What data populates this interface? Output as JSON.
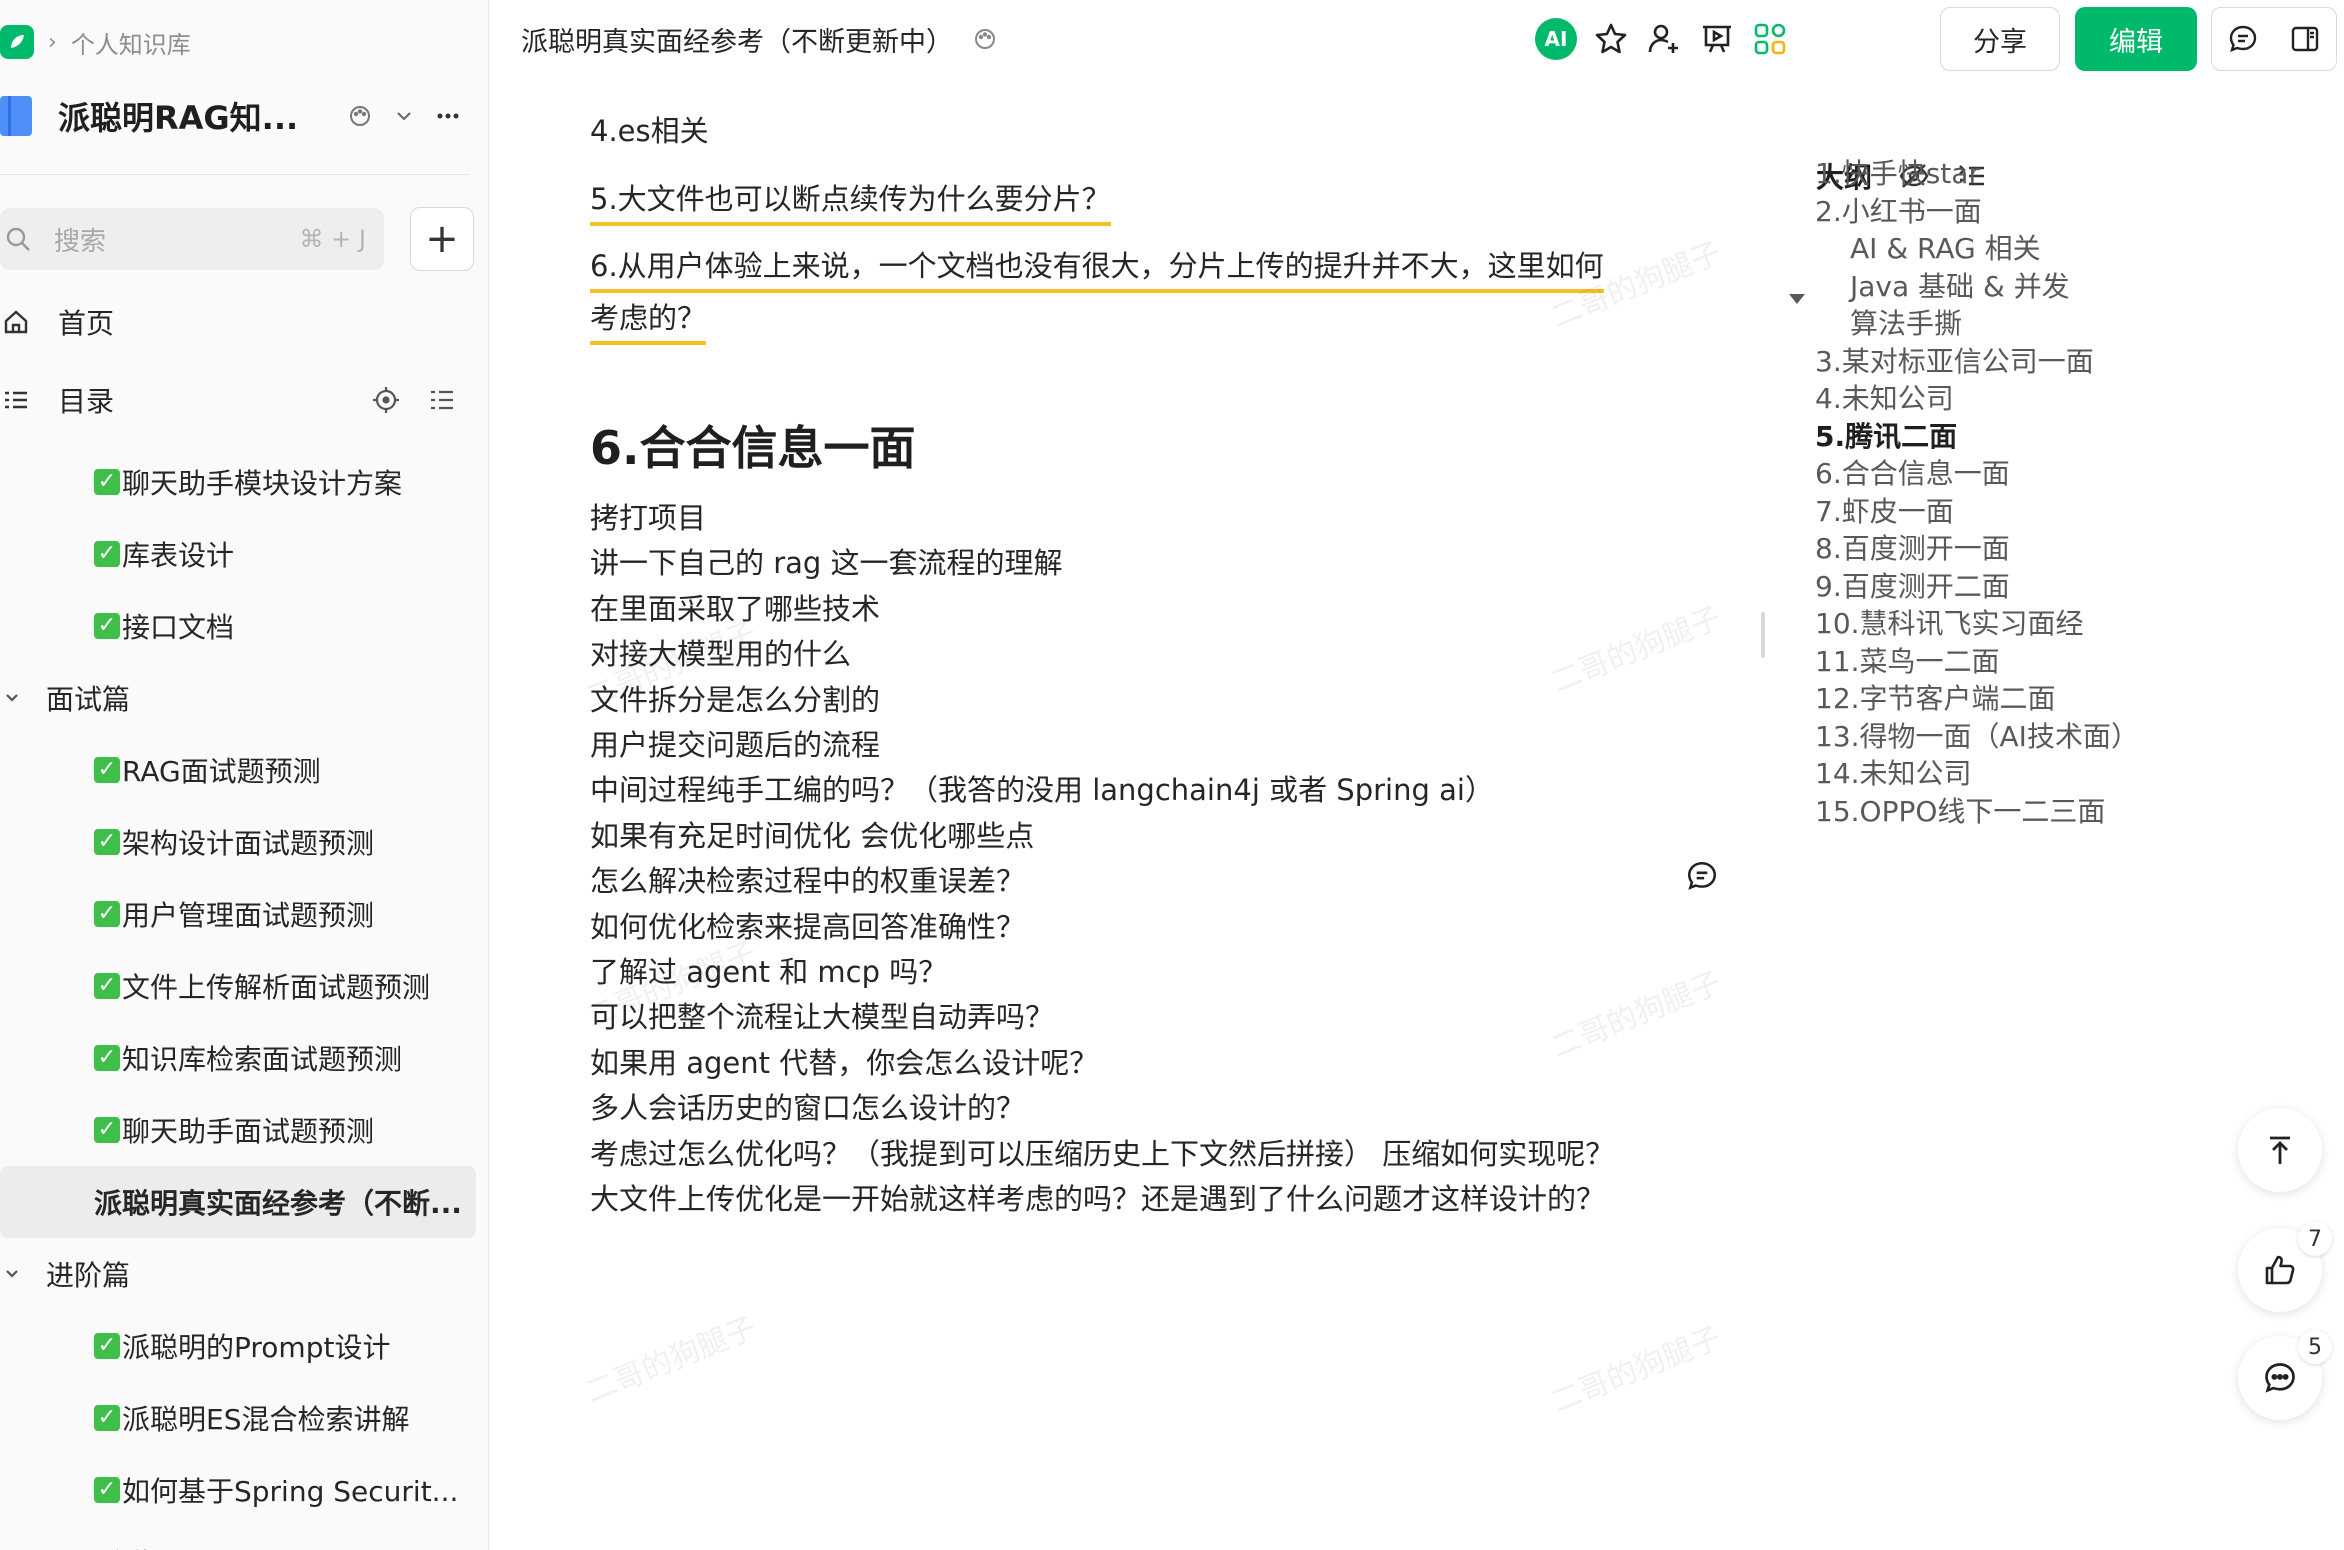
{
  "breadcrumb": {
    "label": "个人知识库"
  },
  "sidebar": {
    "book_title": "派聪明RAG知...",
    "search": {
      "placeholder": "搜索",
      "shortcut": "⌘ + J"
    },
    "nav": {
      "home": "首页",
      "catalog": "目录"
    },
    "tree": [
      {
        "type": "leaf",
        "check": "✓",
        "label": "聊天助手模块设计方案"
      },
      {
        "type": "leaf",
        "check": "✓",
        "label": "库表设计"
      },
      {
        "type": "leaf",
        "check": "✓",
        "label": "接口文档"
      },
      {
        "type": "group",
        "label": "面试篇"
      },
      {
        "type": "leaf",
        "check": "✓",
        "label": "RAG面试题预测"
      },
      {
        "type": "leaf",
        "check": "✓",
        "label": "架构设计面试题预测"
      },
      {
        "type": "leaf",
        "check": "✓",
        "label": "用户管理面试题预测"
      },
      {
        "type": "leaf",
        "check": "✓",
        "label": "文件上传解析面试题预测"
      },
      {
        "type": "leaf",
        "check": "✓",
        "label": "知识库检索面试题预测"
      },
      {
        "type": "leaf",
        "check": "✓",
        "label": "聊天助手面试题预测"
      },
      {
        "type": "leaf",
        "active": true,
        "label": "派聪明真实面经参考（不断..."
      },
      {
        "type": "group",
        "label": "进阶篇"
      },
      {
        "type": "leaf",
        "check": "✓",
        "label": "派聪明的Prompt设计"
      },
      {
        "type": "leaf",
        "check": "✓",
        "label": "派聪明ES混合检索讲解"
      },
      {
        "type": "leaf",
        "check": "✓",
        "label": "如何基于Spring Securit..."
      },
      {
        "type": "leaf",
        "label": "派聪明 QA"
      }
    ]
  },
  "topbar": {
    "doc_title": "派聪明真实面经参考（不断更新中）",
    "ai_label": "AI",
    "share_label": "分享",
    "edit_label": "编辑"
  },
  "content": {
    "top_items": [
      "4.es相关",
      "5.大文件也可以断点续传为什么要分片？",
      "6.从用户体验上来说，一个文档也没有很大，分片上传的提升并不大，这里如何",
      "考虑的？"
    ],
    "heading": "6.合合信息一面",
    "items": [
      "拷打项目",
      "讲一下自己的 rag 这一套流程的理解",
      "在里面采取了哪些技术",
      "对接大模型用的什么",
      "文件拆分是怎么分割的",
      "用户提交问题后的流程",
      "中间过程纯手工编的吗？（我答的没用 langchain4j 或者 Spring ai）",
      "如果有充足时间优化 会优化哪些点",
      "怎么解决检索过程中的权重误差？",
      "如何优化检索来提高回答准确性？",
      "了解过 agent 和 mcp 吗？",
      "可以把整个流程让大模型自动弄吗？",
      "如果用 agent 代替，你会怎么设计呢？",
      "多人会话历史的窗口怎么设计的？",
      "考虑过怎么优化吗？（我提到可以压缩历史上下文然后拼接） 压缩如何实现呢？",
      "大文件上传优化是一开始就这样考虑的吗？还是遇到了什么问题才这样设计的？"
    ],
    "watermark": "二哥的狗腿子"
  },
  "outline": {
    "title": "大纲",
    "items": [
      {
        "label": "1.快手快star",
        "level": 1
      },
      {
        "label": "2.小红书一面",
        "level": 1
      },
      {
        "label": "AI & RAG 相关",
        "level": 2
      },
      {
        "label": "Java 基础 & 并发",
        "level": 2
      },
      {
        "label": "算法手撕",
        "level": 2
      },
      {
        "label": "3.某对标亚信公司一面",
        "level": 1
      },
      {
        "label": "4.未知公司",
        "level": 1
      },
      {
        "label": "5.腾讯二面",
        "level": 1,
        "active": true
      },
      {
        "label": "6.合合信息一面",
        "level": 1
      },
      {
        "label": "7.虾皮一面",
        "level": 1
      },
      {
        "label": "8.百度测开一面",
        "level": 1
      },
      {
        "label": "9.百度测开二面",
        "level": 1
      },
      {
        "label": "10.慧科讯飞实习面经",
        "level": 1
      },
      {
        "label": "11.菜鸟一二面",
        "level": 1
      },
      {
        "label": "12.字节客户端二面",
        "level": 1
      },
      {
        "label": "13.得物一面（AI技术面）",
        "level": 1
      },
      {
        "label": "14.未知公司",
        "level": 1
      },
      {
        "label": "15.OPPO线下一二三面",
        "level": 1
      }
    ]
  },
  "floating": {
    "like_count": "7",
    "comment_count": "5"
  },
  "colors": {
    "accent": "#00b96b",
    "highlight": "#fbbf24",
    "check": "#3fbf4a"
  }
}
